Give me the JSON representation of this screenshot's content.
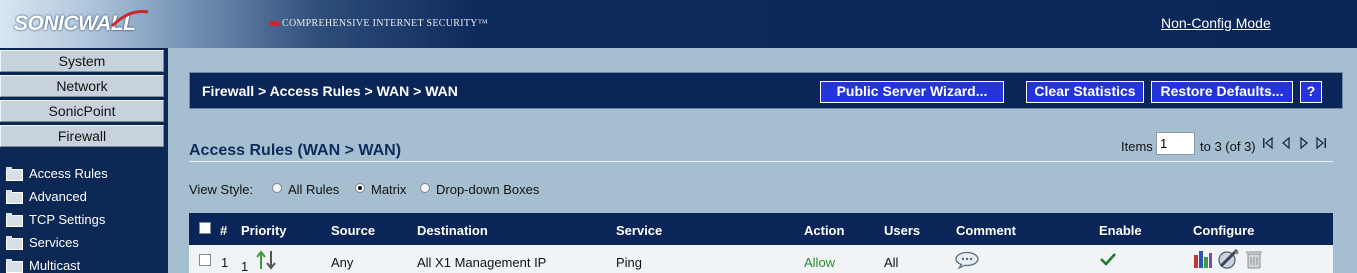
{
  "header": {
    "logo_text": "SONICWALL",
    "tagline": "COMPREHENSIVE INTERNET SECURITY™",
    "mode_link": "Non-Config Mode"
  },
  "sidebar": {
    "nav_buttons": [
      "System",
      "Network",
      "SonicPoint",
      "Firewall"
    ],
    "items": [
      "Access Rules",
      "Advanced",
      "TCP Settings",
      "Services",
      "Multicast"
    ]
  },
  "main": {
    "breadcrumb": "Firewall > Access Rules > WAN > WAN",
    "buttons": {
      "wizard": "Public Server Wizard...",
      "clear": "Clear Statistics",
      "restore": "Restore Defaults...",
      "help": "?"
    },
    "section_title": "Access Rules (WAN > WAN)",
    "pager": {
      "items_label": "Items",
      "items_value": "1",
      "range_label": "to 3 (of 3)"
    },
    "view_style": {
      "label": "View Style:",
      "options": [
        "All Rules",
        "Matrix",
        "Drop-down Boxes"
      ],
      "selected": "Matrix"
    },
    "table": {
      "columns": [
        "#",
        "Priority",
        "Source",
        "Destination",
        "Service",
        "Action",
        "Users",
        "Comment",
        "Enable",
        "Configure"
      ],
      "rows": [
        {
          "num": "1",
          "priority": "1",
          "source": "Any",
          "destination": "All X1 Management IP",
          "service": "Ping",
          "action": "Allow",
          "users": "All"
        }
      ]
    }
  },
  "colors": {
    "navy": "#0a2658",
    "button_blue": "#2434d8",
    "background": "#a6bfd0",
    "allow_green": "#2c8a2c"
  }
}
